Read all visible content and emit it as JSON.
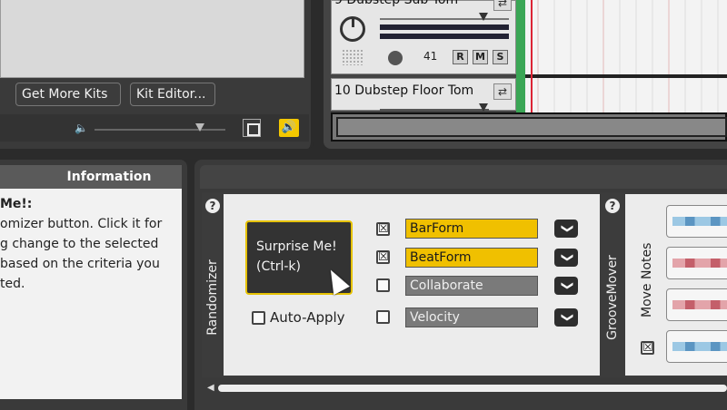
{
  "kit": {
    "get_more_kits": "Get More Kits",
    "kit_editor": "Kit Editor..."
  },
  "tracks": [
    {
      "name": "9 Dubstep Sub Tom",
      "volume": "41",
      "buttons": [
        "R",
        "M",
        "S"
      ]
    },
    {
      "name": "10 Dubstep Floor Tom"
    }
  ],
  "information": {
    "header": "Information",
    "title": "Me!:",
    "lines": [
      "omizer button. Click it for",
      "g change to the selected",
      "based on the criteria you",
      "ted."
    ]
  },
  "randomizer": {
    "label": "Randomizer",
    "surprise_line1": "Surprise Me!",
    "surprise_line2": "(Ctrl-k)",
    "auto_apply": "Auto-Apply",
    "auto_apply_checked": false,
    "options": [
      {
        "label": "BarForm",
        "checked": true
      },
      {
        "label": "BeatForm",
        "checked": true
      },
      {
        "label": "Collaborate",
        "checked": false
      },
      {
        "label": "Velocity",
        "checked": false
      }
    ],
    "accent_color": "#f0c000"
  },
  "groove_mover": {
    "label": "GrooveMover",
    "move_notes": "Move Notes",
    "move_notes_checked": true,
    "pattern_colors": [
      "#7ab3d9",
      "#d9848c",
      "#d9848c",
      "#7ab3d9"
    ]
  },
  "icons": {
    "help": "?",
    "checked": "☒",
    "unchecked": "",
    "chevron": "❯",
    "speaker": "🔈",
    "speaker_active": "🔊",
    "swap": "⇄",
    "scroll_left": "◀"
  }
}
